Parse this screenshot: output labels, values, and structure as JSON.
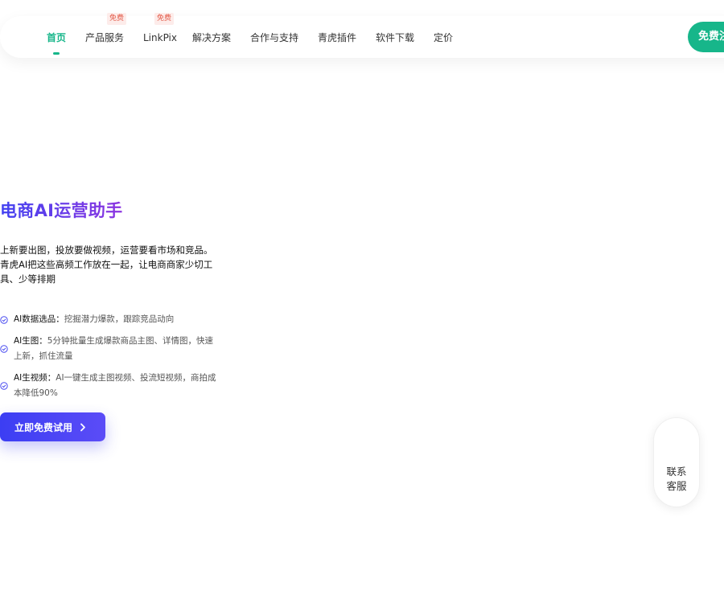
{
  "nav": {
    "items": [
      {
        "label": "首页",
        "active": true
      },
      {
        "label": "产品服务",
        "badge": "免费"
      },
      {
        "label": "LinkPix",
        "badge": "免费"
      },
      {
        "label": "解决方案"
      },
      {
        "label": "合作与支持"
      },
      {
        "label": "青虎插件"
      },
      {
        "label": "软件下载"
      },
      {
        "label": "定价"
      }
    ],
    "cta_label": "免费注册"
  },
  "hero": {
    "title": "电商AI运营助手",
    "desc_line1": "上新要出图，投放要做视频，运营要看市场和竞品。",
    "desc_line2": "青虎AI把这些高频工作放在一起，让电商商家少切工具、少等排期",
    "features": [
      {
        "name": "AI数据选品：",
        "text": "挖掘潜力爆款，跟踪竞品动向"
      },
      {
        "name": "AI生图：",
        "text": "5分钟批量生成爆款商品主图、详情图，快速上新，抓住流量"
      },
      {
        "name": "AI生视频：",
        "text": "AI一键生成主图视频、投流短视频，商拍成本降低90%"
      }
    ],
    "cta_label": "立即免费试用"
  },
  "contact": {
    "line1": "联系",
    "line2": "客服"
  },
  "colors": {
    "accent_green": "#17b68a",
    "accent_blue": "#3c3ef3",
    "badge_red": "#e35b4a"
  },
  "icons": {
    "feature_check": "check-circle-icon",
    "cta_arrow": "chevron-right-icon"
  }
}
